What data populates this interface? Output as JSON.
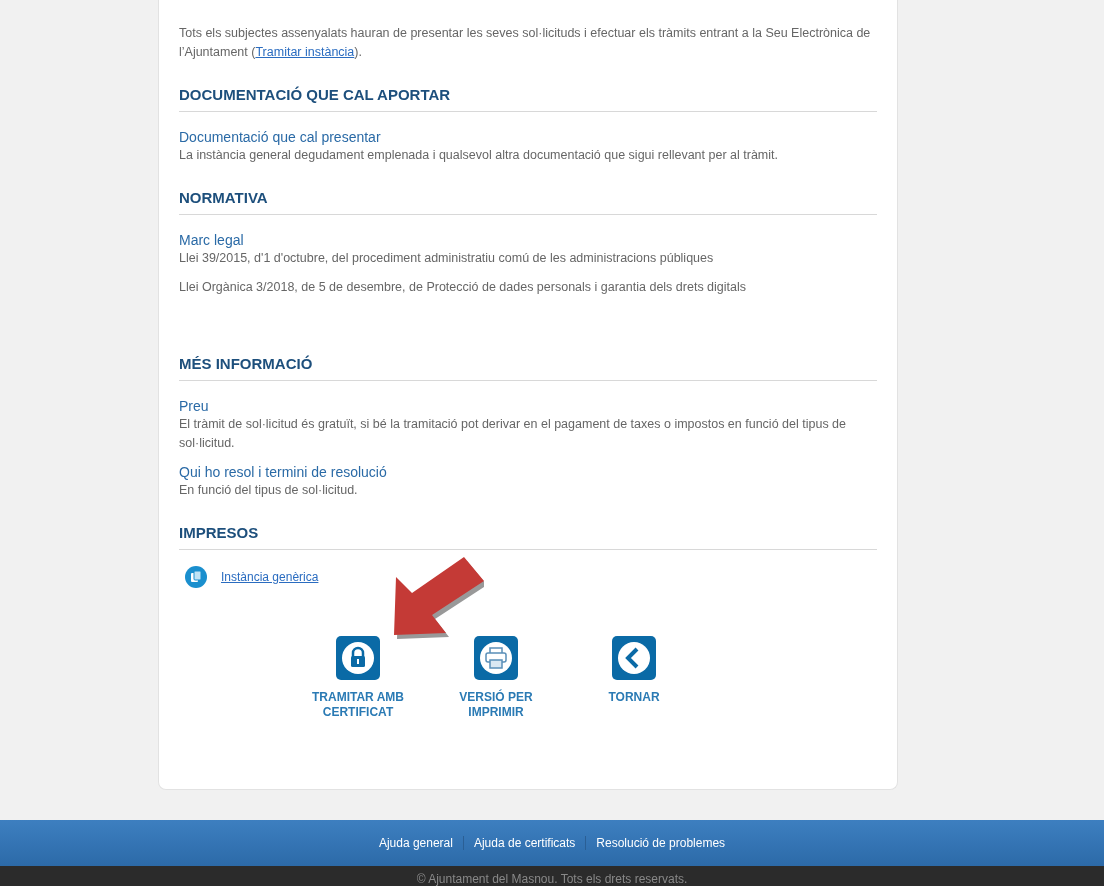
{
  "intro": {
    "text_before": "Tots els subjectes assenyalats hauran de presentar les seves sol·licituds i efectuar els tràmits entrant a la Seu Electrònica de l’Ajuntament (",
    "link": "Tramitar instància",
    "text_after": ")."
  },
  "sections": [
    {
      "kind": "info",
      "title": "DOCUMENTACIÓ QUE CAL APORTAR",
      "items": [
        {
          "title": "Documentació que cal presentar",
          "paragraphs": [
            "La instància general degudament emplenada i qualsevol altra documentació que sigui rellevant per al tràmit."
          ]
        }
      ]
    },
    {
      "kind": "info",
      "title": "NORMATIVA",
      "items": [
        {
          "title": "Marc legal",
          "paragraphs": [
            "Llei 39/2015, d'1 d'octubre, del procediment administratiu comú de les administracions públiques",
            "Llei Orgànica 3/2018, de 5 de desembre, de Protecció de dades personals i garantia dels drets digitals"
          ]
        }
      ]
    },
    {
      "kind": "info",
      "title": "MÉS INFORMACIÓ",
      "items": [
        {
          "title": "Preu",
          "paragraphs": [
            "El tràmit de sol·licitud és gratuït, si bé la tramitació pot derivar en el pagament de taxes o impostos en funció del tipus de sol·licitud."
          ]
        },
        {
          "title": "Qui ho resol i termini de resolució",
          "paragraphs": [
            "En funció del tipus de sol·licitud."
          ]
        }
      ]
    },
    {
      "kind": "downloads",
      "title": "IMPRESOS",
      "items": [
        {
          "title": "Instància genèrica"
        }
      ]
    }
  ],
  "actions": [
    {
      "kind": "lock",
      "label": "TRAMITAR AMB CERTIFICAT"
    },
    {
      "kind": "printer",
      "label": "VERSIÓ PER IMPRIMIR"
    },
    {
      "kind": "back",
      "label": "TORNAR"
    }
  ],
  "footer": {
    "links": [
      "Ajuda general",
      "Ajuda de certificats",
      "Resolució de problemes"
    ],
    "copyright": "© Ajuntament del Masnou. Tots els drets reservats."
  }
}
